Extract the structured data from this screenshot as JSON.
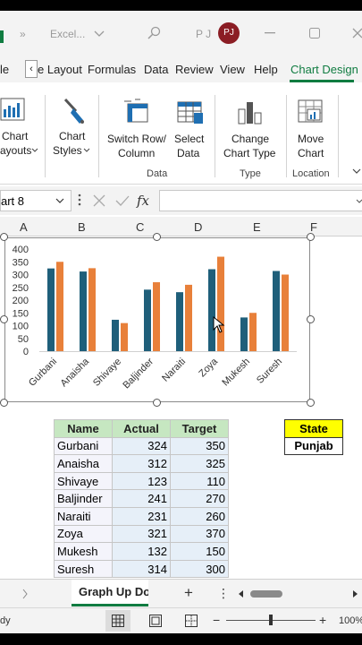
{
  "titlebar": {
    "title": "Excel...",
    "user_initials_text": "P J",
    "avatar_initials": "PJ",
    "back_glyph": "»"
  },
  "ribbon_tabs": [
    {
      "label": "le"
    },
    {
      "label": "e Layout"
    },
    {
      "label": "Formulas"
    },
    {
      "label": "Data"
    },
    {
      "label": "Review"
    },
    {
      "label": "View"
    },
    {
      "label": "Help"
    },
    {
      "label": "Chart Design"
    }
  ],
  "ribbon": {
    "quick_layout": {
      "line1": "Chart",
      "line2": "ayouts"
    },
    "chart_styles": {
      "line1": "Chart",
      "line2": "Styles"
    },
    "switch_row_column": {
      "line1": "Switch Row/",
      "line2": "Column"
    },
    "select_data": {
      "line1": "Select",
      "line2": "Data"
    },
    "change_chart_type": {
      "line1": "Change",
      "line2": "Chart Type"
    },
    "move_chart": {
      "line1": "Move",
      "line2": "Chart"
    },
    "groups": {
      "data": "Data",
      "type": "Type",
      "location": "Location"
    }
  },
  "formula_bar": {
    "name_box": "art 8",
    "fx": "fx"
  },
  "columns": [
    "A",
    "B",
    "C",
    "D",
    "E",
    "F"
  ],
  "chart_data": {
    "type": "bar",
    "categories": [
      "Gurbani",
      "Anaisha",
      "Shivaye",
      "Baljinder",
      "Naraiti",
      "Zoya",
      "Mukesh",
      "Suresh"
    ],
    "series": [
      {
        "values": [
          324,
          312,
          123,
          241,
          231,
          321,
          132,
          314
        ],
        "color": "#1f5f7a"
      },
      {
        "values": [
          350,
          325,
          110,
          270,
          260,
          370,
          150,
          300
        ],
        "color": "#e8803a"
      }
    ],
    "y_ticks": [
      "0",
      "50",
      "100",
      "150",
      "200",
      "250",
      "300",
      "350",
      "400"
    ],
    "ylim": [
      0,
      400
    ],
    "grid": false
  },
  "table": {
    "headers": [
      "Name",
      "Actual",
      "Target"
    ],
    "rows": [
      [
        "Gurbani",
        "324",
        "350"
      ],
      [
        "Anaisha",
        "312",
        "325"
      ],
      [
        "Shivaye",
        "123",
        "110"
      ],
      [
        "Baljinder",
        "241",
        "270"
      ],
      [
        "Naraiti",
        "231",
        "260"
      ],
      [
        "Zoya",
        "321",
        "370"
      ],
      [
        "Mukesh",
        "132",
        "150"
      ],
      [
        "Suresh",
        "314",
        "300"
      ]
    ]
  },
  "state": {
    "header": "State",
    "value": "Punjab"
  },
  "sheet_tabs": {
    "active": "Graph Up Do",
    "add": "+",
    "more": "⋮"
  },
  "status": {
    "text": "dy",
    "zoom": "100%",
    "minus": "−",
    "plus": "+"
  },
  "colors": {
    "accent": "#107c41",
    "header_fill": "#c6e7c1",
    "state_fill": "#ffff00"
  }
}
